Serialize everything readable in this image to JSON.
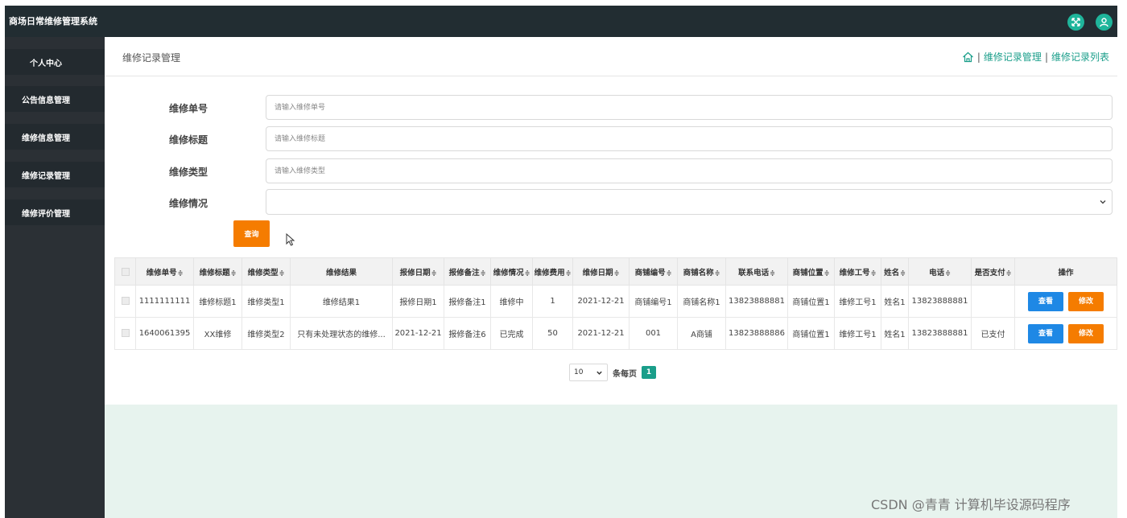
{
  "header": {
    "title": "商场日常维修管理系统"
  },
  "sidebar": {
    "items": [
      {
        "label": "个人中心"
      },
      {
        "label": "公告信息管理"
      },
      {
        "label": "维修信息管理"
      },
      {
        "label": "维修记录管理"
      },
      {
        "label": "维修评价管理"
      }
    ]
  },
  "page": {
    "title": "维修记录管理",
    "breadcrumb": [
      "维修记录管理",
      "维修记录列表"
    ],
    "breadcrumb_sep": "|"
  },
  "search": {
    "fields": [
      {
        "label": "维修单号",
        "placeholder": "请输入维修单号"
      },
      {
        "label": "维修标题",
        "placeholder": "请输入维修标题"
      },
      {
        "label": "维修类型",
        "placeholder": "请输入维修类型"
      },
      {
        "label": "维修情况",
        "value": ""
      }
    ],
    "query_label": "查询"
  },
  "table": {
    "columns": [
      "维修单号",
      "维修标题",
      "维修类型",
      "维修结果",
      "报修日期",
      "报修备注",
      "维修情况",
      "维修费用",
      "维修日期",
      "商铺编号",
      "商铺名称",
      "联系电话",
      "商铺位置",
      "维修工号",
      "姓名",
      "电话",
      "是否支付",
      "操作"
    ],
    "sortable": [
      true,
      true,
      true,
      false,
      true,
      true,
      true,
      true,
      true,
      true,
      true,
      true,
      true,
      true,
      true,
      true,
      true,
      false
    ],
    "sort_mark": "≑",
    "rows": [
      [
        "1111111111",
        "维修标题1",
        "维修类型1",
        "维修结果1",
        "报修日期1",
        "报修备注1",
        "维修中",
        "1",
        "2021-12-21",
        "商铺编号1",
        "商铺名称1",
        "13823888881",
        "商铺位置1",
        "维修工号1",
        "姓名1",
        "13823888881",
        ""
      ],
      [
        "1640061395",
        "XX维修",
        "维修类型2",
        "只有未处理状态的维修...",
        "2021-12-21",
        "报修备注6",
        "已完成",
        "50",
        "2021-12-21",
        "001",
        "A商铺",
        "13823888886",
        "商铺位置1",
        "维修工号1",
        "姓名1",
        "13823888881",
        "已支付"
      ]
    ],
    "view_label": "查看",
    "edit_label": "修改"
  },
  "pagination": {
    "page_size": "10",
    "per_page_label": "条每页",
    "current_page": "1"
  },
  "watermark": "CSDN @青青 计算机毕设源码程序",
  "colors": {
    "primary": "#1a9e8a",
    "orange": "#f57c00",
    "blue": "#1e88e5",
    "dark": "#222d32"
  }
}
